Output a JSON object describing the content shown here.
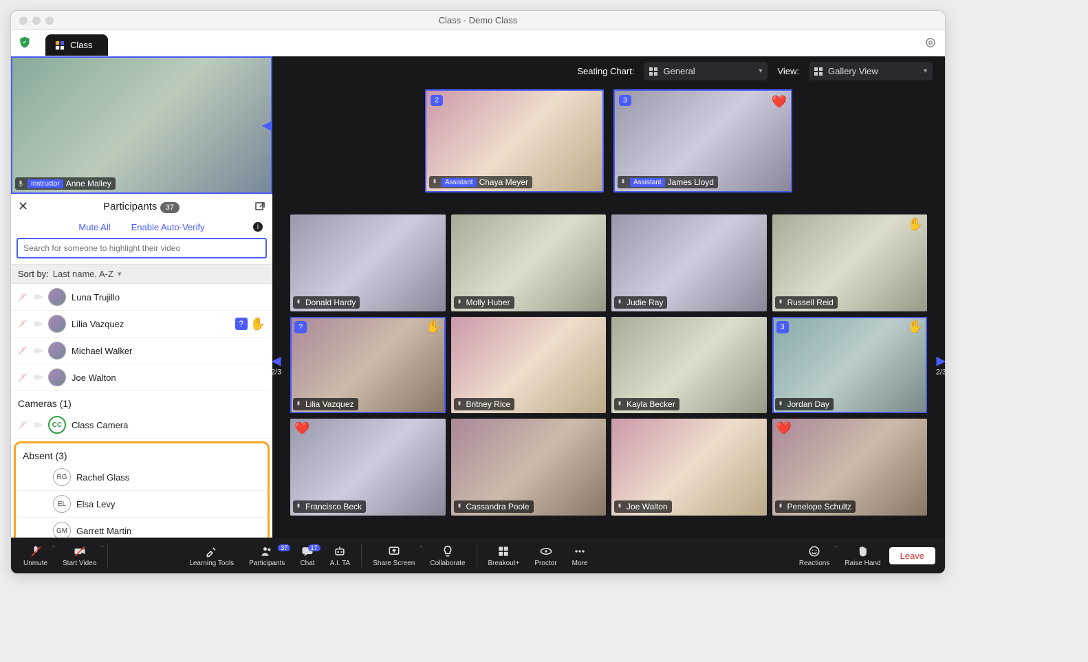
{
  "window": {
    "title": "Class - Demo Class",
    "tab_label": "Class"
  },
  "controls": {
    "seating_label": "Seating Chart:",
    "seating_value": "General",
    "view_label": "View:",
    "view_value": "Gallery View",
    "page_indicator": "2/3"
  },
  "instructor": {
    "name": "Anne Malley",
    "role": "Instructor"
  },
  "assistants": [
    {
      "name": "Chaya Meyer",
      "role": "Assistant",
      "badge": "2"
    },
    {
      "name": "James Lloyd",
      "role": "Assistant",
      "badge": "3",
      "emoji": "❤️"
    }
  ],
  "panel": {
    "title": "Participants",
    "count": "37",
    "mute_all": "Mute All",
    "auto_verify": "Enable Auto-Verify",
    "search_placeholder": "Search for someone to highlight their video",
    "sort_label": "Sort by:",
    "sort_value": "Last name, A-Z",
    "cameras_label": "Cameras  (1)",
    "camera_name": "Class Camera",
    "camera_initials": "CC",
    "absent_label": "Absent  (3)"
  },
  "participants": [
    {
      "name": "Luna Trujillo"
    },
    {
      "name": "Lilia Vazquez",
      "question": true,
      "hand": true
    },
    {
      "name": "Michael Walker"
    },
    {
      "name": "Joe Walton"
    }
  ],
  "absent": [
    {
      "name": "Rachel Glass",
      "initials": "RG"
    },
    {
      "name": "Elsa Levy",
      "initials": "EL"
    },
    {
      "name": "Garrett Martin",
      "initials": "GM"
    }
  ],
  "gallery": [
    {
      "name": "Donald Hardy",
      "bg": "bg3"
    },
    {
      "name": "Molly Huber",
      "bg": "bg4"
    },
    {
      "name": "Judie Ray",
      "bg": "bg3"
    },
    {
      "name": "Russell Reid",
      "bg": "bg4",
      "hand_r": true
    },
    {
      "name": "Lilia Vazquez",
      "bg": "bg5",
      "sel": true,
      "question": true,
      "hand_r": true
    },
    {
      "name": "Britney Rice",
      "bg": "bg2"
    },
    {
      "name": "Kayla Becker",
      "bg": "bg4"
    },
    {
      "name": "Jordan Day",
      "bg": "bg6",
      "sel": true,
      "num": "3",
      "hand_r": true
    },
    {
      "name": "Francisco Beck",
      "bg": "bg3",
      "heart": true
    },
    {
      "name": "Cassandra Poole",
      "bg": "bg5"
    },
    {
      "name": "Joe Walton",
      "bg": "bg2"
    },
    {
      "name": "Penelope Schultz",
      "bg": "bg5",
      "heart": true
    }
  ],
  "bottombar": {
    "unmute": "Unmute",
    "start_video": "Start Video",
    "learning_tools": "Learning Tools",
    "participants": "Participants",
    "participants_count": "37",
    "chat": "Chat",
    "chat_count": "17",
    "ai_ta": "A.I. TA",
    "share_screen": "Share Screen",
    "collaborate": "Collaborate",
    "breakout": "Breakout+",
    "proctor": "Proctor",
    "more": "More",
    "reactions": "Reactions",
    "raise_hand": "Raise Hand",
    "leave": "Leave"
  }
}
